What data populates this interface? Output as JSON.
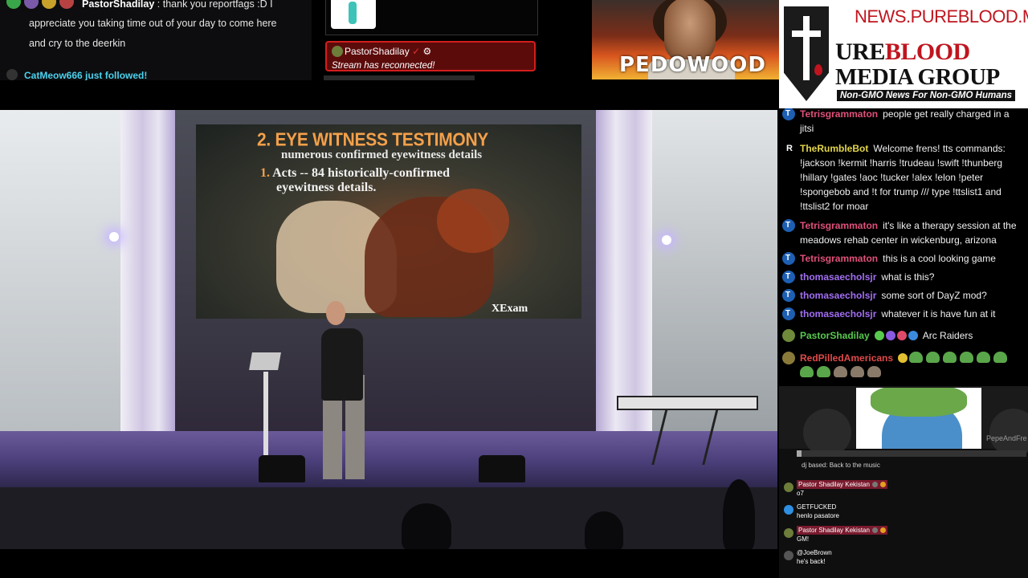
{
  "top_chat": {
    "username": "PastorShadilay",
    "message_line1": "thank you reportfags :D I",
    "message_line2": "appreciate you taking time out of your day to come here",
    "message_line3": "and cry to the deerkin",
    "follow_notice": "CatMeow666 just followed!"
  },
  "alert": {
    "username": "PastorShadilay",
    "message": "Stream has reconnected!"
  },
  "thumbnail": {
    "caption": "PEDOWOOD"
  },
  "brand": {
    "url": "NEWS.PUREBLOOD.MEDIA",
    "line1_a": "URE",
    "line1_b": "BLOOD",
    "line2": "MEDIA GROUP",
    "tagline": "Non-GMO News For Non-GMO Humans"
  },
  "slide": {
    "title": "2. EYE WITNESS TESTIMONY",
    "subtitle": "numerous confirmed eyewitness details",
    "bullet_num": "1.",
    "bullet_line1": "Acts -- 84 historically-confirmed",
    "bullet_line2": "eyewitness details.",
    "signature": "XExam"
  },
  "chat": {
    "messages": [
      {
        "user": "Tetrisgrammaton",
        "text": "people get really charged in a jitsi",
        "color": "pink",
        "avatar": "T"
      },
      {
        "user": "TheRumbleBot",
        "text": "Welcome frens! tts commands: !jackson !kermit !harris !trudeau !swift !thunberg !hillary !gates !aoc !tucker !alex !elon !peter !spongebob and !t for trump /// type !ttslist1 and !ttslist2 for moar",
        "color": "yellow",
        "avatar": "R"
      },
      {
        "user": "Tetrisgrammaton",
        "text": "it's like a therapy session at the meadows rehab center in wickenburg, arizona",
        "color": "pink",
        "avatar": "T"
      },
      {
        "user": "Tetrisgrammaton",
        "text": "this is a cool looking game",
        "color": "pink",
        "avatar": "T"
      },
      {
        "user": "thomasaecholsjr",
        "text": "what is this?",
        "color": "purple",
        "avatar": "T"
      },
      {
        "user": "thomasaecholsjr",
        "text": "some sort of DayZ mod?",
        "color": "purple",
        "avatar": "T"
      },
      {
        "user": "thomasaecholsjr",
        "text": "whatever it is have fun at it",
        "color": "purple",
        "avatar": "T"
      },
      {
        "user": "PastorShadilay",
        "text": "Arc Raiders",
        "color": "green",
        "avatar": "G"
      },
      {
        "user": "RedPilledAmericans",
        "text": "",
        "color": "red",
        "avatar": "G"
      }
    ]
  },
  "panel": {
    "media_tag": "PepeAndFre",
    "now_playing": "dj based: Back to the music",
    "progress": 0.02,
    "messages": [
      {
        "user": "Pastor Shadilay Kekistan",
        "text": "o7",
        "highlight": true
      },
      {
        "user": "GETFUCKED",
        "text": "henlo pasatore",
        "highlight": false
      },
      {
        "user": "Pastor Shadilay Kekistan",
        "text": "GM!",
        "highlight": true
      },
      {
        "user": "@JoeBrown",
        "text": "he's back!",
        "highlight": false
      }
    ]
  },
  "colors": {
    "alert_border": "#d31d1d",
    "brand_red": "#c0151f",
    "follow_cyan": "#4ad2ee"
  }
}
